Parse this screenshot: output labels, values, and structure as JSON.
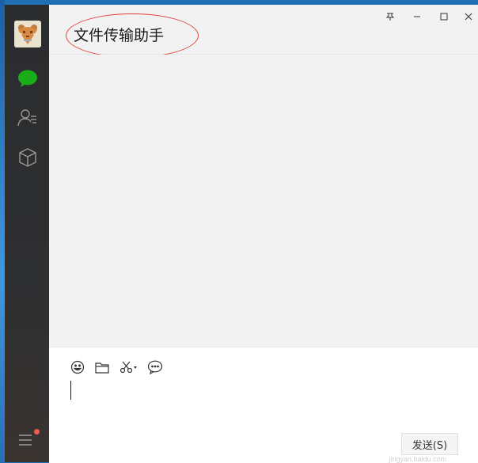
{
  "window": {
    "title": "文件传输助手"
  },
  "window_controls": {
    "pin": "pin-icon",
    "minimize": "minimize-icon",
    "maximize": "maximize-icon",
    "close": "close-icon"
  },
  "sidebar": {
    "items": [
      {
        "name": "chats",
        "icon": "chat-bubble-icon",
        "active": true,
        "color": "#1aad19"
      },
      {
        "name": "contacts",
        "icon": "contacts-icon",
        "active": false
      },
      {
        "name": "mini-programs",
        "icon": "cube-icon",
        "active": false
      }
    ],
    "menu_icon": "menu-icon",
    "notification_color": "#f25b4f"
  },
  "composer": {
    "tools": [
      "emoji-icon",
      "folder-icon",
      "scissors-icon",
      "chat-history-icon"
    ],
    "send_label": "发送(S)"
  },
  "watermark": {
    "text": "Baidu",
    "sub": "jingyan.baidu.com"
  }
}
